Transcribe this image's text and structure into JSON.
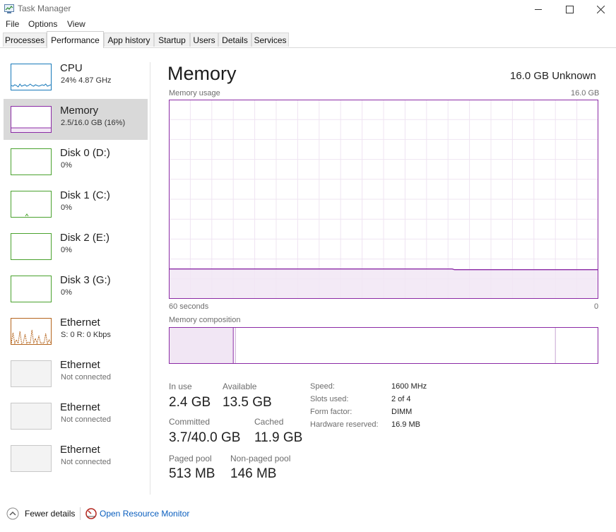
{
  "window": {
    "title": "Task Manager"
  },
  "menu": {
    "items": [
      "File",
      "Options",
      "View"
    ]
  },
  "tabs": [
    "Processes",
    "Performance",
    "App history",
    "Startup",
    "Users",
    "Details",
    "Services"
  ],
  "active_tab": "Performance",
  "sidebar": {
    "items": [
      {
        "title": "CPU",
        "subtitle": "24%  4.87 GHz",
        "kind": "cpu",
        "color": "#1779ba",
        "selected": false
      },
      {
        "title": "Memory",
        "subtitle": "2.5/16.0 GB (16%)",
        "kind": "memory",
        "color": "#8b2aa5",
        "selected": true
      },
      {
        "title": "Disk 0 (D:)",
        "subtitle": "0%",
        "kind": "disk",
        "color": "#4aa22e",
        "selected": false
      },
      {
        "title": "Disk 1 (C:)",
        "subtitle": "0%",
        "kind": "disk",
        "color": "#4aa22e",
        "selected": false
      },
      {
        "title": "Disk 2 (E:)",
        "subtitle": "0%",
        "kind": "disk",
        "color": "#4aa22e",
        "selected": false
      },
      {
        "title": "Disk 3 (G:)",
        "subtitle": "0%",
        "kind": "disk",
        "color": "#4aa22e",
        "selected": false
      },
      {
        "title": "Ethernet",
        "subtitle": "S: 0  R: 0 Kbps",
        "kind": "ethernet",
        "color": "#b5651d",
        "selected": false
      },
      {
        "title": "Ethernet",
        "subtitle": "Not connected",
        "kind": "ethernet-off",
        "color": "#c8c8c8",
        "selected": false
      },
      {
        "title": "Ethernet",
        "subtitle": "Not connected",
        "kind": "ethernet-off",
        "color": "#c8c8c8",
        "selected": false
      },
      {
        "title": "Ethernet",
        "subtitle": "Not connected",
        "kind": "ethernet-off",
        "color": "#c8c8c8",
        "selected": false
      }
    ]
  },
  "main": {
    "title": "Memory",
    "spec": "16.0 GB Unknown",
    "usage_label": "Memory usage",
    "usage_max": "16.0 GB",
    "time_left": "60 seconds",
    "time_right": "0",
    "composition_label": "Memory composition",
    "usage_fraction": 0.15,
    "composition": {
      "in_use_fraction": 0.15,
      "modified_fraction": 0.005,
      "standby_fraction": 0.745
    },
    "accent_color": "#8b2aa5",
    "stats": {
      "in_use": {
        "label": "In use",
        "value": "2.4 GB"
      },
      "available": {
        "label": "Available",
        "value": "13.5 GB"
      },
      "committed": {
        "label": "Committed",
        "value": "3.7/40.0 GB"
      },
      "cached": {
        "label": "Cached",
        "value": "11.9 GB"
      },
      "paged_pool": {
        "label": "Paged pool",
        "value": "513 MB"
      },
      "non_paged_pool": {
        "label": "Non-paged pool",
        "value": "146 MB"
      }
    },
    "details": [
      {
        "label": "Speed:",
        "value": "1600 MHz"
      },
      {
        "label": "Slots used:",
        "value": "2 of 4"
      },
      {
        "label": "Form factor:",
        "value": "DIMM"
      },
      {
        "label": "Hardware reserved:",
        "value": "16.9 MB"
      }
    ]
  },
  "footer": {
    "fewer_details": "Fewer details",
    "open_resource_monitor": "Open Resource Monitor"
  }
}
